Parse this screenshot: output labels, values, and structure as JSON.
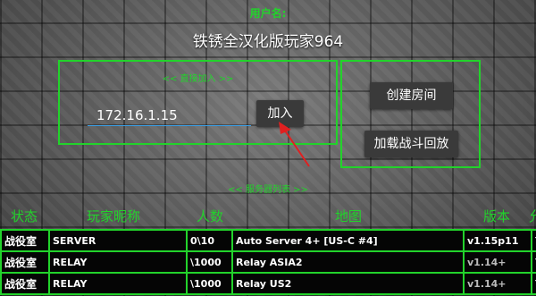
{
  "header": {
    "username_label": "用户名:",
    "username_value": "铁锈全汉化版玩家964"
  },
  "direct_join": {
    "title": "<< 直接加入 >>",
    "ip_value": "172.16.1.15",
    "join_label": "加入"
  },
  "side_actions": {
    "create_room_label": "创建房间",
    "load_replay_label": "加载战斗回放"
  },
  "server_list": {
    "title": "<< 服务器列表 >>",
    "columns": [
      "状态",
      "玩家昵称",
      "人数",
      "地图",
      "版本",
      "允"
    ],
    "rows": [
      [
        "战役室",
        "SERVER",
        "0\\10",
        "Auto Server 4+ [US-C #4]",
        "v1.15p11",
        "Y"
      ],
      [
        "战役室",
        "RELAY",
        "\\1000",
        "Relay ASIA2",
        "v1.14+",
        "Y"
      ],
      [
        "战役室",
        "RELAY",
        "\\1000",
        "Relay US2",
        "v1.14+",
        "Y"
      ]
    ]
  },
  "colors": {
    "accent_green": "#22d32b",
    "input_underline": "#3aa0e8",
    "annotation_arrow": "#e02020"
  }
}
